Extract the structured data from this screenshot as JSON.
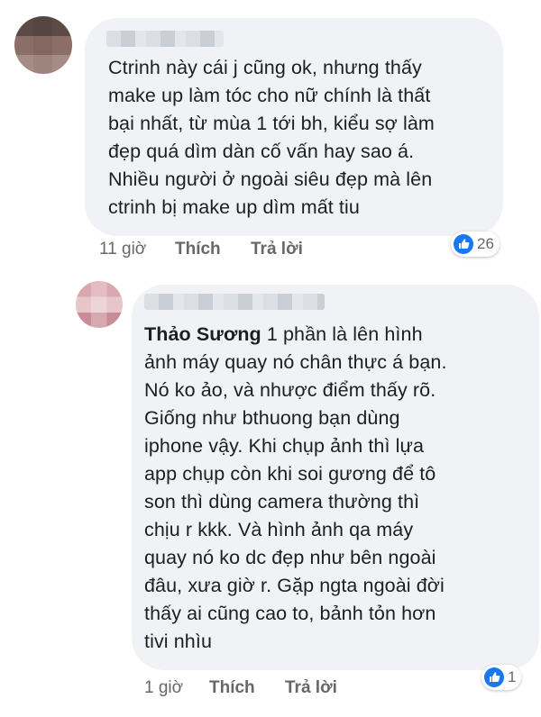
{
  "colors": {
    "bubble": "#f0f2f5",
    "link": "#65676b",
    "like": "#1877f2"
  },
  "comments": [
    {
      "text": "Ctrinh này cái j cũng ok, nhưng thấy\nmake up làm tóc cho nữ chính là thất\nbại nhất, từ mùa 1 tới bh, kiểu sợ làm\nđẹp quá dìm dàn cố vấn hay sao á.\nNhiều người ở ngoài siêu đẹp mà lên\nctrinh bị make up dìm mất tiu",
      "time": "11 giờ",
      "like_label": "Thích",
      "reply_label": "Trả lời",
      "reaction_count": "26",
      "reaction_icon": "like-icon"
    },
    {
      "author": "Thảo Sương",
      "text": " 1 phần là lên hình\nảnh máy quay nó chân thực á bạn.\nNó ko ảo, và nhược điểm thấy rõ.\nGiống như bthuong bạn dùng\niphone vậy. Khi chụp ảnh thì lựa\napp chụp còn khi soi gương để tô\nson thì dùng camera thường thì\nchịu r kkk. Và hình ảnh qa máy\nquay nó ko dc đẹp như bên ngoài\nđâu, xưa giờ r. Gặp ngta ngoài đời\nthấy ai cũng cao to, bảnh tỏn hơn\ntivi nhìu",
      "time": "1 giờ",
      "like_label": "Thích",
      "reply_label": "Trả lời",
      "reaction_count": "1",
      "reaction_icon": "like-icon"
    }
  ]
}
